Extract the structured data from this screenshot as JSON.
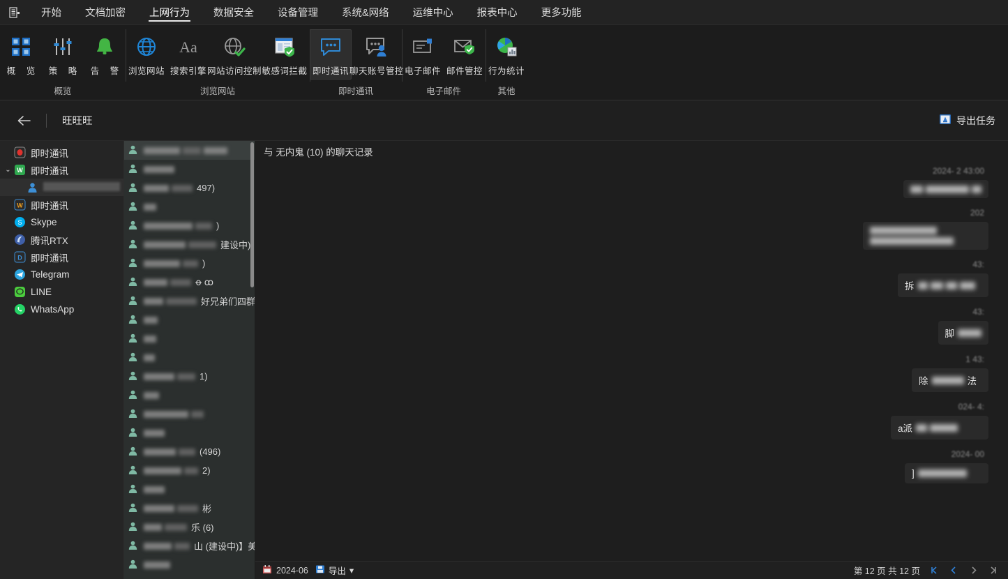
{
  "menubar": {
    "logo_icon": "document-list-icon",
    "items": [
      {
        "label": "开始",
        "active": false
      },
      {
        "label": "文档加密",
        "active": false
      },
      {
        "label": "上网行为",
        "active": true
      },
      {
        "label": "数据安全",
        "active": false
      },
      {
        "label": "设备管理",
        "active": false
      },
      {
        "label": "系统&网络",
        "active": false
      },
      {
        "label": "运维中心",
        "active": false
      },
      {
        "label": "报表中心",
        "active": false
      },
      {
        "label": "更多功能",
        "active": false
      }
    ]
  },
  "ribbon": {
    "groups": [
      {
        "label": "概览",
        "buttons": [
          {
            "label": "概 览",
            "icon": "grid-blue-icon",
            "active": false,
            "spaced": true
          },
          {
            "label": "策 略",
            "icon": "sliders-icon",
            "active": false,
            "spaced": true
          },
          {
            "label": "告 警",
            "icon": "bell-green-icon",
            "active": false,
            "spaced": true
          }
        ]
      },
      {
        "label": "浏览网站",
        "buttons": [
          {
            "label": "浏览网站",
            "icon": "globe-blue-icon",
            "active": false
          },
          {
            "label": "搜索引擎",
            "icon": "font-aa-icon",
            "active": false
          },
          {
            "label": "网站访问控制",
            "icon": "globe-check-icon",
            "active": false
          },
          {
            "label": "敏感词拦截",
            "icon": "window-shield-icon",
            "active": false
          }
        ]
      },
      {
        "label": "即时通讯",
        "buttons": [
          {
            "label": "即时通讯",
            "icon": "chat-bubble-blue-icon",
            "active": true
          },
          {
            "label": "聊天账号管控",
            "icon": "chat-user-icon",
            "active": false
          }
        ]
      },
      {
        "label": "电子邮件",
        "buttons": [
          {
            "label": "电子邮件",
            "icon": "mail-icon",
            "active": false
          },
          {
            "label": "邮件管控",
            "icon": "mail-shield-icon",
            "active": false
          }
        ]
      },
      {
        "label": "其他",
        "buttons": [
          {
            "label": "行为统计",
            "icon": "pie-chart-icon",
            "active": false
          }
        ]
      }
    ]
  },
  "navbar": {
    "back_icon": "arrow-left-icon",
    "title": "旺旺旺",
    "export_task": {
      "label": "导出任务",
      "icon": "export-task-icon"
    }
  },
  "sidebar": {
    "items": [
      {
        "label": "即时通讯",
        "icon": "qq-red-icon",
        "level": 0,
        "caret": "",
        "selected": false
      },
      {
        "label": "即时通讯",
        "icon": "wechat-work-icon",
        "level": 0,
        "caret": "expanded",
        "selected": false
      },
      {
        "label": "",
        "icon": "user-blue-icon",
        "level": 1,
        "caret": "",
        "selected": true,
        "redacted": true
      },
      {
        "label": "即时通讯",
        "icon": "wangwang-icon",
        "level": 0,
        "caret": "",
        "selected": false
      },
      {
        "label": "Skype",
        "icon": "skype-icon",
        "level": 0,
        "caret": "",
        "selected": false
      },
      {
        "label": "腾讯RTX",
        "icon": "rtx-icon",
        "level": 0,
        "caret": "",
        "selected": false
      },
      {
        "label": "即时通讯",
        "icon": "dingtalk-icon",
        "level": 0,
        "caret": "",
        "selected": false
      },
      {
        "label": "Telegram",
        "icon": "telegram-icon",
        "level": 0,
        "caret": "",
        "selected": false
      },
      {
        "label": "LINE",
        "icon": "line-icon",
        "level": 0,
        "caret": "",
        "selected": false
      },
      {
        "label": "WhatsApp",
        "icon": "whatsapp-icon",
        "level": 0,
        "caret": "",
        "selected": false
      }
    ]
  },
  "contacts": {
    "rows": [
      {
        "selected": true,
        "bars": [
          52,
          26,
          34
        ],
        "tail": ""
      },
      {
        "selected": false,
        "bars": [
          44
        ],
        "tail": ""
      },
      {
        "selected": false,
        "bars": [
          36,
          30
        ],
        "tail": "497)"
      },
      {
        "selected": false,
        "bars": [
          18
        ],
        "tail": ""
      },
      {
        "selected": false,
        "bars": [
          70,
          24
        ],
        "tail": ")"
      },
      {
        "selected": false,
        "bars": [
          60,
          40
        ],
        "tail": "建设中)】美..."
      },
      {
        "selected": false,
        "bars": [
          52,
          22
        ],
        "tail": ")"
      },
      {
        "selected": false,
        "bars": [
          34,
          30
        ],
        "tail": "ꝋ ꝏ"
      },
      {
        "selected": false,
        "bars": [
          28,
          44
        ],
        "tail": "好兄弟们四群..."
      },
      {
        "selected": false,
        "bars": [
          20
        ],
        "tail": ""
      },
      {
        "selected": false,
        "bars": [
          18
        ],
        "tail": ""
      },
      {
        "selected": false,
        "bars": [
          16
        ],
        "tail": ""
      },
      {
        "selected": false,
        "bars": [
          44,
          26
        ],
        "tail": "1)"
      },
      {
        "selected": false,
        "bars": [
          22
        ],
        "tail": ""
      },
      {
        "selected": false,
        "bars": [
          64,
          18
        ],
        "tail": ""
      },
      {
        "selected": false,
        "bars": [
          30
        ],
        "tail": ""
      },
      {
        "selected": false,
        "bars": [
          46,
          24
        ],
        "tail": "(496)"
      },
      {
        "selected": false,
        "bars": [
          54,
          20
        ],
        "tail": "2)"
      },
      {
        "selected": false,
        "bars": [
          30
        ],
        "tail": ""
      },
      {
        "selected": false,
        "bars": [
          44,
          30
        ],
        "tail": "彬"
      },
      {
        "selected": false,
        "bars": [
          26,
          32
        ],
        "tail": "乐    (6)"
      },
      {
        "selected": false,
        "bars": [
          40,
          22
        ],
        "tail": "山   (建设中)】美..."
      },
      {
        "selected": false,
        "bars": [
          38
        ],
        "tail": ""
      }
    ]
  },
  "chat": {
    "header": "与 无内鬼 (10) 的聊天记录",
    "messages": [
      {
        "time": "2024-    2        43:00",
        "bars": [
          18,
          62,
          14
        ],
        "text": "",
        "bubble_w": 96
      },
      {
        "time": "202                       ",
        "bars": [
          96,
          120
        ],
        "text": "",
        "bubble_w": 180,
        "two_line": true
      },
      {
        "time": "                    43:",
        "bars": [
          14,
          18,
          16,
          22
        ],
        "text": "拆        ",
        "bubble_w": 130
      },
      {
        "time": "                    43:",
        "bars": [
          34
        ],
        "text": "脚",
        "bubble_w": 70
      },
      {
        "time": "1             43:",
        "bars": [
          46
        ],
        "text": "除  ",
        "text_after": "法",
        "bubble_w": 110
      },
      {
        "time": "024-                 4:",
        "bars": [
          16,
          40
        ],
        "text": "a派",
        "bubble_w": 140
      },
      {
        "time": "2024-                   00",
        "bars": [
          70
        ],
        "text": "]",
        "bubble_w": 120
      }
    ]
  },
  "footer": {
    "date_icon": "calendar-icon",
    "date_text": "2024-06",
    "export": {
      "label": "导出",
      "icon": "export-icon",
      "caret": "▾"
    },
    "pagination": {
      "text": "第 12 页  共 12 页",
      "first_icon": "first-page-icon",
      "prev_icon": "prev-page-icon",
      "next_icon": "next-page-icon",
      "last_icon": "last-page-icon"
    }
  }
}
